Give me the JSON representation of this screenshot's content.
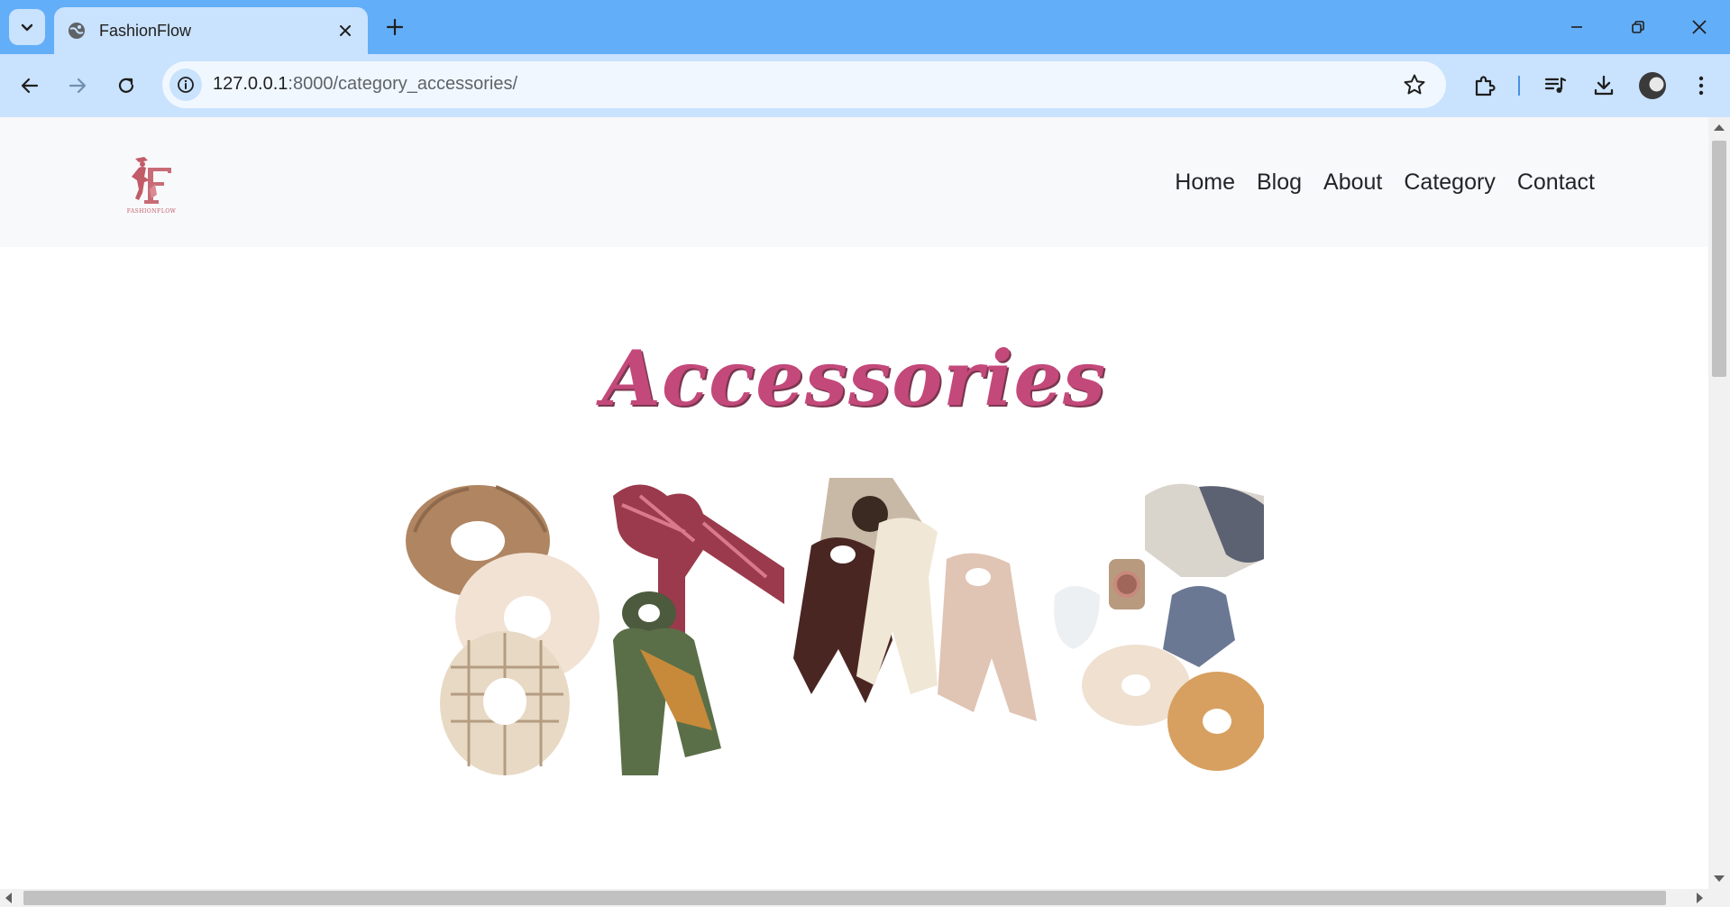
{
  "browser": {
    "tab_title": "FashionFlow",
    "url_host": "127.0.0.1",
    "url_path": ":8000/category_accessories/"
  },
  "site": {
    "logo_text": "FASHIONFLOW",
    "nav": [
      "Home",
      "Blog",
      "About",
      "Category",
      "Contact"
    ],
    "heading": "Accessories"
  },
  "colors": {
    "tab_strip": "#63aef8",
    "toolbar": "#c9e2fd",
    "header_bg": "#f8f9fa",
    "heading": "#c4497b",
    "logo": "#c25b68"
  },
  "icons": {
    "tab_search": "chevron-down-icon",
    "favicon": "globe-icon",
    "close_tab": "close-icon",
    "new_tab": "plus-icon",
    "back": "arrow-left-icon",
    "forward": "arrow-right-icon",
    "reload": "reload-icon",
    "site_info": "info-icon",
    "bookmark": "star-icon",
    "extensions": "puzzle-icon",
    "media": "media-queue-icon",
    "downloads": "download-icon",
    "menu": "kebab-menu-icon"
  }
}
